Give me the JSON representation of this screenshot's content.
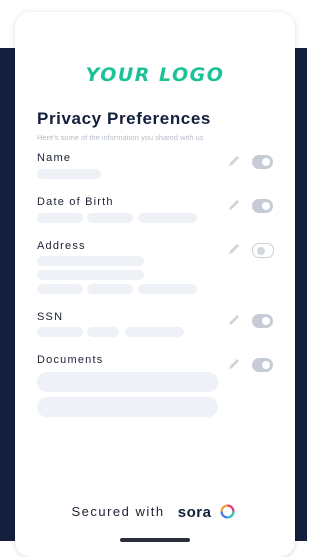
{
  "logo": "YOUR LOGO",
  "title": "Privacy Preferences",
  "subtitle": "Here's some of the information you shared with us",
  "fields": [
    {
      "label": "Name",
      "toggle": "on"
    },
    {
      "label": "Date of Birth",
      "toggle": "on"
    },
    {
      "label": "Address",
      "toggle": "off"
    },
    {
      "label": "SSN",
      "toggle": "on"
    },
    {
      "label": "Documents",
      "toggle": "on"
    }
  ],
  "footer": {
    "text": "Secured with",
    "brand": "sora"
  },
  "colors": {
    "accent": "#1cc297",
    "navy": "#141f3e",
    "placeholder": "#eef1f5",
    "toggle": "#c6ccd5"
  },
  "icons": {
    "edit": "pencil-icon",
    "brand_ring": "sora-ring-icon"
  }
}
